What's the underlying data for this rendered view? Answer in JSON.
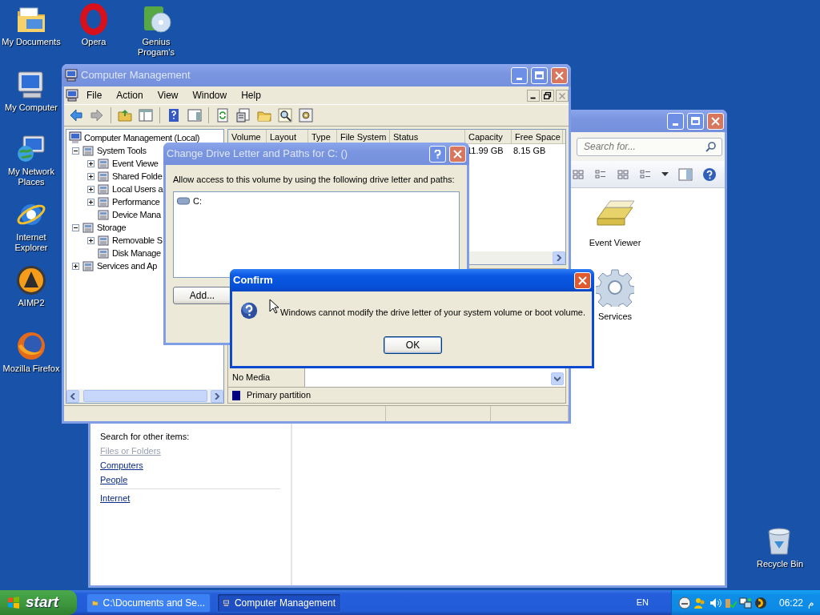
{
  "desktop_icons": [
    {
      "label": "My Documents"
    },
    {
      "label": "Opera"
    },
    {
      "label": "Genius Progam's"
    },
    {
      "label": "My Computer"
    },
    {
      "label": "My Network Places"
    },
    {
      "label": "Internet Explorer"
    },
    {
      "label": "AIMP2"
    },
    {
      "label": "Mozilla Firefox"
    },
    {
      "label": "Recycle Bin"
    }
  ],
  "explorer_window": {
    "search": {
      "placeholder": "Search for..."
    },
    "items": [
      {
        "label": "Event Viewer"
      },
      {
        "label": "Services"
      }
    ],
    "search_heading": "Search for other items:",
    "links": [
      {
        "label": "Files or Folders",
        "disabled": true
      },
      {
        "label": "Computers",
        "disabled": false
      },
      {
        "label": "People",
        "disabled": false
      },
      {
        "label": "Internet",
        "disabled": false
      }
    ]
  },
  "computer_management": {
    "title": "Computer Management",
    "menu": [
      "File",
      "Action",
      "View",
      "Window",
      "Help"
    ],
    "tree": [
      {
        "label": "Computer Management (Local)",
        "children": [
          {
            "label": "System Tools",
            "expanded": true,
            "children": [
              {
                "label": "Event Viewe",
                "expanded": false
              },
              {
                "label": "Shared Folde",
                "expanded": false
              },
              {
                "label": "Local Users a",
                "expanded": false
              },
              {
                "label": "Performance",
                "expanded": false
              },
              {
                "label": "Device Mana"
              }
            ]
          },
          {
            "label": "Storage",
            "expanded": true,
            "children": [
              {
                "label": "Removable S",
                "expanded": false
              },
              {
                "label": "Disk Manage"
              }
            ]
          },
          {
            "label": "Services and Ap",
            "expanded": false
          }
        ]
      }
    ],
    "columns": [
      "Volume",
      "Layout",
      "Type",
      "File System",
      "Status",
      "Capacity",
      "Free Space"
    ],
    "rows": [
      {
        "capacity": "11.99 GB",
        "free_space": "8.15 GB"
      }
    ],
    "disk_cell": "No Media",
    "legend": {
      "label": "Primary partition",
      "color": "#000080"
    }
  },
  "drive_dialog": {
    "title": "Change Drive Letter and Paths for C: ()",
    "prompt": "Allow access to this volume by using the following drive letter and paths:",
    "paths": [
      "C:"
    ],
    "buttons": [
      "Add..."
    ]
  },
  "confirm_dialog": {
    "title": "Confirm",
    "message": "Windows cannot modify the drive letter of your system volume or boot volume.",
    "buttons": [
      "OK"
    ]
  },
  "taskbar": {
    "start": "start",
    "tasks": [
      {
        "label": "C:\\Documents and Se...",
        "selected": false
      },
      {
        "label": "Computer Management",
        "selected": true
      }
    ],
    "language": "EN",
    "clock": "06:22",
    "am_pm": "م"
  }
}
